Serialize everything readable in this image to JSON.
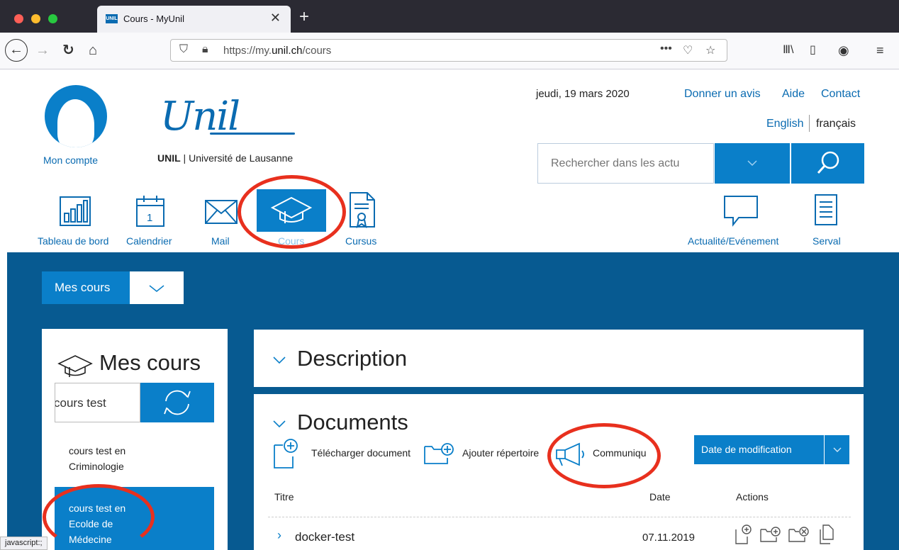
{
  "browser": {
    "tab_title": "Cours - MyUnil",
    "favicon_text": "UNIL",
    "url_prefix": "https://my.",
    "url_domain": "unil.ch",
    "url_path": "/cours",
    "status_text": "javascript:;"
  },
  "header": {
    "account_label": "Mon compte",
    "logo_script": "Unil",
    "logo_short": "UNIL",
    "logo_full": "Université de Lausanne",
    "date": "jeudi, 19 mars 2020",
    "links": [
      "Donner un avis",
      "Aide",
      "Contact"
    ],
    "lang_en": "English",
    "lang_fr": "français",
    "search_placeholder": "Rechercher dans les actu"
  },
  "nav": {
    "items": [
      {
        "label": "Tableau de bord",
        "icon": "dashboard-icon"
      },
      {
        "label": "Calendrier",
        "icon": "calendar-icon",
        "day": "1"
      },
      {
        "label": "Mail",
        "icon": "mail-icon"
      },
      {
        "label": "Cours",
        "icon": "graduation-cap-icon",
        "active": true
      },
      {
        "label": "Cursus",
        "icon": "certificate-icon"
      },
      {
        "label": "Actualité/Evénement",
        "icon": "speech-bubble-icon"
      },
      {
        "label": "Serval",
        "icon": "document-icon"
      }
    ]
  },
  "courses_dropdown": {
    "label": "Mes cours"
  },
  "sidebar": {
    "title": "Mes cours",
    "search_value": "cours test",
    "items": [
      {
        "lines": [
          "cours test en",
          "Criminologie"
        ],
        "active": false
      },
      {
        "lines": [
          "cours test en",
          "Ecolde de",
          "Médecine"
        ],
        "active": true
      }
    ]
  },
  "main": {
    "description_title": "Description",
    "documents_title": "Documents",
    "toolbar": {
      "upload": "Télécharger document",
      "add_folder": "Ajouter répertoire",
      "announce": "Communiqu"
    },
    "sort_label": "Date de modification",
    "columns": [
      "Titre",
      "Date",
      "Actions"
    ],
    "rows": [
      {
        "title": "docker-test",
        "date": "07.11.2019"
      }
    ]
  },
  "colors": {
    "brand_blue": "#0a7fc9",
    "dark_blue": "#075a91",
    "annotation_red": "#e8301e"
  }
}
